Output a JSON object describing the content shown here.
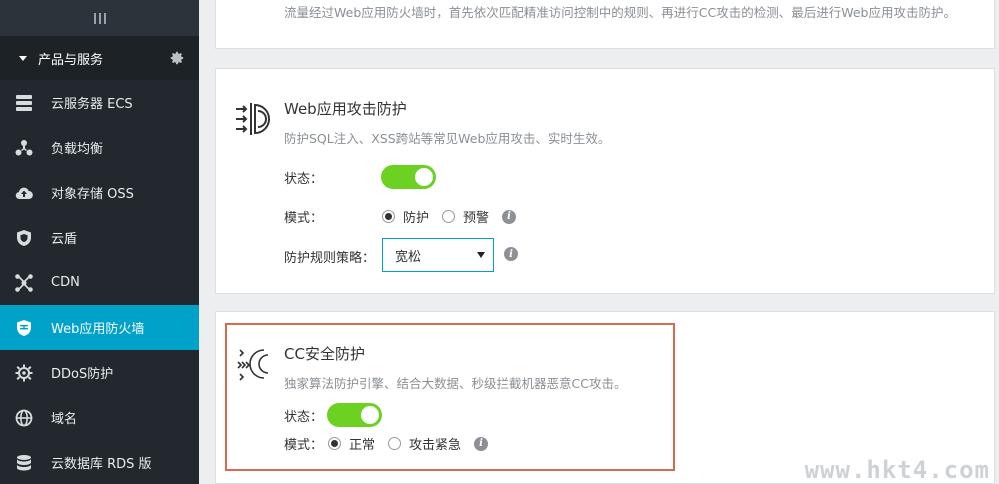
{
  "sidebar": {
    "section_label": "产品与服务",
    "items": [
      {
        "label": "云服务器 ECS",
        "icon": "server-icon",
        "active": false
      },
      {
        "label": "负载均衡",
        "icon": "load-balance-icon",
        "active": false
      },
      {
        "label": "对象存储 OSS",
        "icon": "cloud-upload-icon",
        "active": false
      },
      {
        "label": "云盾",
        "icon": "shield-icon",
        "active": false
      },
      {
        "label": "CDN",
        "icon": "cdn-icon",
        "active": false
      },
      {
        "label": "Web应用防火墙",
        "icon": "firewall-icon",
        "active": true
      },
      {
        "label": "DDoS防护",
        "icon": "ddos-icon",
        "active": false
      },
      {
        "label": "域名",
        "icon": "globe-icon",
        "active": false
      },
      {
        "label": "云数据库 RDS 版",
        "icon": "database-icon",
        "active": false
      }
    ]
  },
  "top_panel": {
    "description": "流量经过Web应用防火墙时，首先依次匹配精准访问控制中的规则、再进行CC攻击的检测、最后进行Web应用攻击防护。"
  },
  "web_protection": {
    "title": "Web应用攻击防护",
    "description": "防护SQL注入、XSS跨站等常见Web应用攻击、实时生效。",
    "status_label": "状态：",
    "status_on": true,
    "mode_label": "模式：",
    "mode_options": [
      "防护",
      "预警"
    ],
    "mode_selected": "防护",
    "policy_label": "防护规则策略：",
    "policy_value": "宽松"
  },
  "cc_protection": {
    "title": "CC安全防护",
    "description": "独家算法防护引擎、结合大数据、秒级拦截机器恶意CC攻击。",
    "status_label": "状态：",
    "status_on": true,
    "mode_label": "模式：",
    "mode_options": [
      "正常",
      "攻击紧急"
    ],
    "mode_selected": "正常"
  },
  "watermark": "www.hkt4.com",
  "colors": {
    "sidebar_bg": "#22282e",
    "active_item": "#00a2ca",
    "toggle_on": "#6cd120",
    "highlight_border": "#d9694f"
  }
}
